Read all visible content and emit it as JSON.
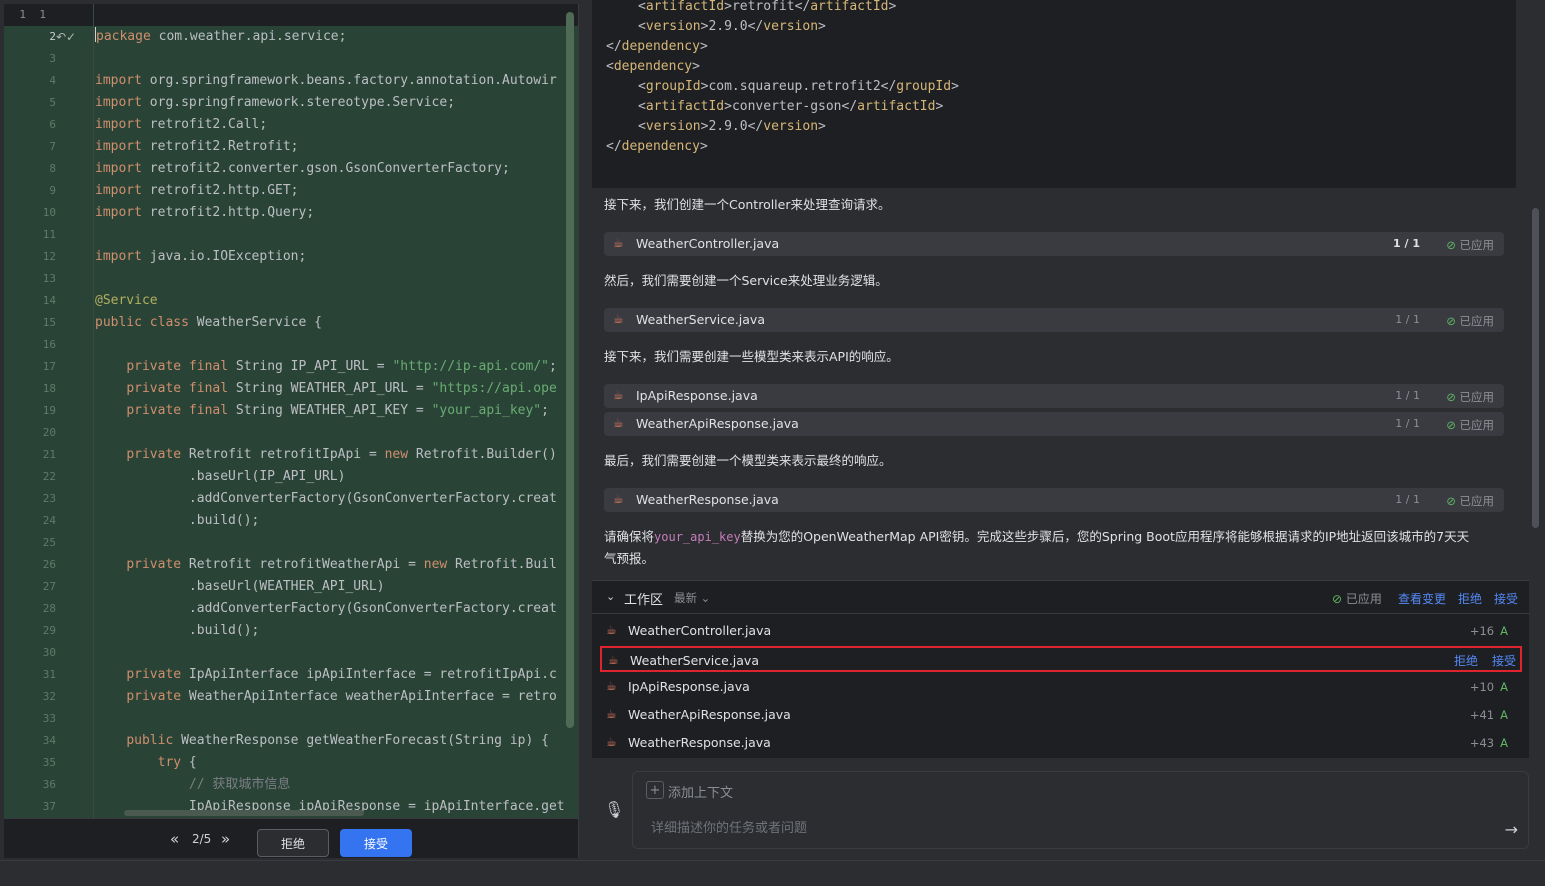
{
  "editor": {
    "top_line_numbers": [
      "1",
      "1"
    ],
    "line_numbers": [
      "2",
      "3",
      "4",
      "5",
      "6",
      "7",
      "8",
      "9",
      "10",
      "11",
      "12",
      "13",
      "14",
      "15",
      "16",
      "17",
      "18",
      "19",
      "20",
      "21",
      "22",
      "23",
      "24",
      "25",
      "26",
      "27",
      "28",
      "29",
      "30",
      "31",
      "32",
      "33",
      "34",
      "35",
      "36",
      "37"
    ],
    "lines": [
      [
        {
          "t": "kw",
          "v": "package"
        },
        {
          "t": "",
          "v": " com.weather.api.service;"
        }
      ],
      [],
      [
        {
          "t": "kw",
          "v": "import"
        },
        {
          "t": "",
          "v": " org.springframework.beans.factory.annotation.Autowir"
        }
      ],
      [
        {
          "t": "kw",
          "v": "import"
        },
        {
          "t": "",
          "v": " org.springframework.stereotype.Service;"
        }
      ],
      [
        {
          "t": "kw",
          "v": "import"
        },
        {
          "t": "",
          "v": " retrofit2.Call;"
        }
      ],
      [
        {
          "t": "kw",
          "v": "import"
        },
        {
          "t": "",
          "v": " retrofit2.Retrofit;"
        }
      ],
      [
        {
          "t": "kw",
          "v": "import"
        },
        {
          "t": "",
          "v": " retrofit2.converter.gson.GsonConverterFactory;"
        }
      ],
      [
        {
          "t": "kw",
          "v": "import"
        },
        {
          "t": "",
          "v": " retrofit2.http.GET;"
        }
      ],
      [
        {
          "t": "kw",
          "v": "import"
        },
        {
          "t": "",
          "v": " retrofit2.http.Query;"
        }
      ],
      [],
      [
        {
          "t": "kw",
          "v": "import"
        },
        {
          "t": "",
          "v": " java.io.IOException;"
        }
      ],
      [],
      [
        {
          "t": "ann",
          "v": "@Service"
        }
      ],
      [
        {
          "t": "kw",
          "v": "public class"
        },
        {
          "t": "",
          "v": " WeatherService {"
        }
      ],
      [],
      [
        {
          "t": "",
          "v": "    "
        },
        {
          "t": "kw",
          "v": "private final"
        },
        {
          "t": "",
          "v": " String IP_API_URL = "
        },
        {
          "t": "str",
          "v": "\"http://ip-api.com/\""
        },
        {
          "t": "",
          "v": ";"
        }
      ],
      [
        {
          "t": "",
          "v": "    "
        },
        {
          "t": "kw",
          "v": "private final"
        },
        {
          "t": "",
          "v": " String WEATHER_API_URL = "
        },
        {
          "t": "str",
          "v": "\"https://api.ope"
        }
      ],
      [
        {
          "t": "",
          "v": "    "
        },
        {
          "t": "kw",
          "v": "private final"
        },
        {
          "t": "",
          "v": " String WEATHER_API_KEY = "
        },
        {
          "t": "str",
          "v": "\"your_api_key\""
        },
        {
          "t": "",
          "v": ";"
        }
      ],
      [],
      [
        {
          "t": "",
          "v": "    "
        },
        {
          "t": "kw",
          "v": "private"
        },
        {
          "t": "",
          "v": " Retrofit retrofitIpApi = "
        },
        {
          "t": "kw",
          "v": "new"
        },
        {
          "t": "",
          "v": " Retrofit.Builder()"
        }
      ],
      [
        {
          "t": "",
          "v": "            .baseUrl(IP_API_URL)"
        }
      ],
      [
        {
          "t": "",
          "v": "            .addConverterFactory(GsonConverterFactory.creat"
        }
      ],
      [
        {
          "t": "",
          "v": "            .build();"
        }
      ],
      [],
      [
        {
          "t": "",
          "v": "    "
        },
        {
          "t": "kw",
          "v": "private"
        },
        {
          "t": "",
          "v": " Retrofit retrofitWeatherApi = "
        },
        {
          "t": "kw",
          "v": "new"
        },
        {
          "t": "",
          "v": " Retrofit.Buil"
        }
      ],
      [
        {
          "t": "",
          "v": "            .baseUrl(WEATHER_API_URL)"
        }
      ],
      [
        {
          "t": "",
          "v": "            .addConverterFactory(GsonConverterFactory.creat"
        }
      ],
      [
        {
          "t": "",
          "v": "            .build();"
        }
      ],
      [],
      [
        {
          "t": "",
          "v": "    "
        },
        {
          "t": "kw",
          "v": "private"
        },
        {
          "t": "",
          "v": " IpApiInterface ipApiInterface = retrofitIpApi.c"
        }
      ],
      [
        {
          "t": "",
          "v": "    "
        },
        {
          "t": "kw",
          "v": "private"
        },
        {
          "t": "",
          "v": " WeatherApiInterface weatherApiInterface = retro"
        }
      ],
      [],
      [
        {
          "t": "",
          "v": "    "
        },
        {
          "t": "kw",
          "v": "public"
        },
        {
          "t": "",
          "v": " WeatherResponse getWeatherForecast(String ip) {"
        }
      ],
      [
        {
          "t": "",
          "v": "        "
        },
        {
          "t": "kw",
          "v": "try"
        },
        {
          "t": "",
          "v": " {"
        }
      ],
      [
        {
          "t": "",
          "v": "            "
        },
        {
          "t": "cm",
          "v": "// 获取城市信息"
        }
      ],
      [
        {
          "t": "",
          "v": "            IpApiResponse ipApiResponse = ipApiInterface.getC"
        }
      ]
    ],
    "gutter_icons": "↶✓",
    "nav_prev": "«",
    "nav_next": "»",
    "diff_counter": "2/5",
    "reject_label": "拒绝",
    "accept_label": "接受"
  },
  "xml_lines": [
    {
      "indent": 1,
      "tag": "artifactId",
      "value": "retrofit"
    },
    {
      "indent": 1,
      "tag": "version",
      "value": "2.9.0"
    },
    {
      "indent": 0,
      "close": "dependency"
    },
    {
      "indent": 0,
      "open": "dependency"
    },
    {
      "indent": 1,
      "tag": "groupId",
      "value": "com.squareup.retrofit2"
    },
    {
      "indent": 1,
      "tag": "artifactId",
      "value": "converter-gson"
    },
    {
      "indent": 1,
      "tag": "version",
      "value": "2.9.0"
    },
    {
      "indent": 0,
      "close": "dependency"
    }
  ],
  "chat": {
    "p1": "接下来，我们创建一个Controller来处理查询请求。",
    "p2": "然后，我们需要创建一个Service来处理业务逻辑。",
    "p3": "接下来，我们需要创建一些模型类来表示API的响应。",
    "p4": "最后，我们需要创建一个模型类来表示最终的响应。",
    "p5_pre": "请确保将",
    "p5_code": "your_api_key",
    "p5_post": "替换为您的OpenWeatherMap API密钥。完成这些步骤后，您的Spring Boot应用程序将能够根据请求的IP地址返回该城市的7天天",
    "p5_line2": "气预报。",
    "applied_label": "已应用",
    "files": [
      {
        "name": "WeatherController.java",
        "count": "1 / 1",
        "bold": true
      },
      {
        "name": "WeatherService.java",
        "count": "1 / 1",
        "bold": false
      },
      {
        "name": "IpApiResponse.java",
        "count": "1 / 1",
        "bold": false
      },
      {
        "name": "WeatherApiResponse.java",
        "count": "1 / 1",
        "bold": false
      },
      {
        "name": "WeatherResponse.java",
        "count": "1 / 1",
        "bold": false
      }
    ]
  },
  "workspace": {
    "title": "工作区",
    "latest": "最新",
    "status": "已应用",
    "view_changes": "查看变更",
    "reject": "拒绝",
    "accept": "接受",
    "files": [
      {
        "name": "WeatherController.java",
        "adds": "+16",
        "flag": "A",
        "selected": false
      },
      {
        "name": "WeatherService.java",
        "adds": "",
        "flag": "",
        "selected": true
      },
      {
        "name": "IpApiResponse.java",
        "adds": "+10",
        "flag": "A",
        "selected": false
      },
      {
        "name": "WeatherApiResponse.java",
        "adds": "+41",
        "flag": "A",
        "selected": false
      },
      {
        "name": "WeatherResponse.java",
        "adds": "+43",
        "flag": "A",
        "selected": false
      }
    ]
  },
  "input": {
    "add_context": "添加上下文",
    "placeholder": "详细描述你的任务或者问题"
  },
  "colors": {
    "accent": "#3574f0",
    "link": "#548af7",
    "selected_border": "#e0242f",
    "diff_bg": "#294436"
  }
}
